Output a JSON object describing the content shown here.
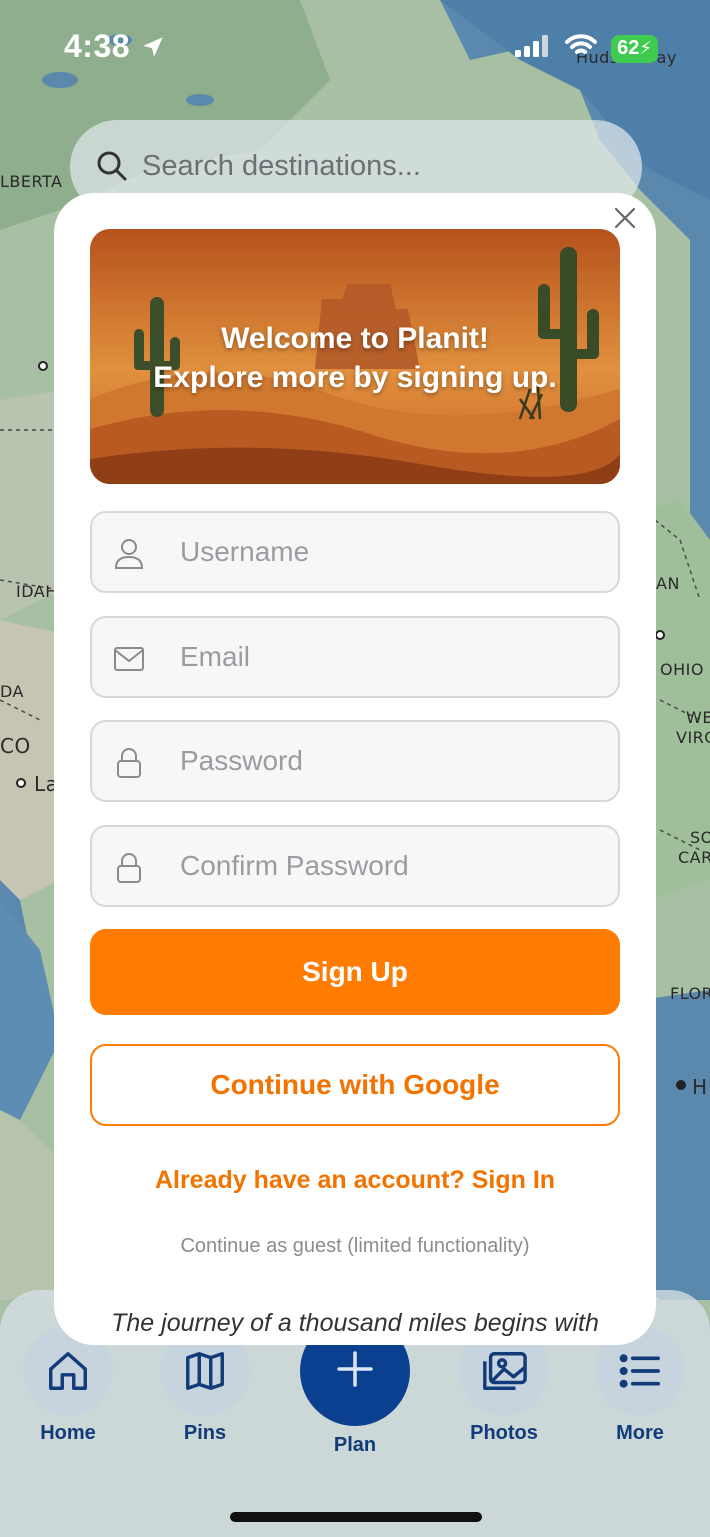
{
  "status_bar": {
    "time": "4:38",
    "battery": "62",
    "icons": [
      "location-arrow-icon",
      "signal-icon",
      "wifi-icon",
      "battery-charging-icon"
    ]
  },
  "map": {
    "labels": {
      "hudson_bay": "Hudson Bay",
      "alberta": "LBERTA",
      "idaho": "IDAH",
      "da": "DA",
      "co": "CO",
      "la": "La",
      "an": "AN",
      "ohio": "OHIO",
      "we": "WE",
      "virg": "VIRG",
      "so": "SO",
      "car": "CAR",
      "flor": "FLOR",
      "h": "H"
    }
  },
  "search": {
    "placeholder": "Search destinations..."
  },
  "modal": {
    "hero": {
      "title_line1": "Welcome to Planit!",
      "title_line2": "Explore more by signing up."
    },
    "fields": {
      "username": {
        "placeholder": "Username",
        "icon": "user-icon"
      },
      "email": {
        "placeholder": "Email",
        "icon": "envelope-icon"
      },
      "password": {
        "placeholder": "Password",
        "icon": "lock-icon"
      },
      "confirm_password": {
        "placeholder": "Confirm Password",
        "icon": "lock-icon"
      }
    },
    "signup_label": "Sign Up",
    "google_label": "Continue with Google",
    "signin_link": "Already have an account? Sign In",
    "guest_link": "Continue as guest (limited functionality)",
    "quote": "The journey of a thousand miles begins with"
  },
  "tab_bar": {
    "home": "Home",
    "pins": "Pins",
    "plan": "Plan",
    "photos": "Photos",
    "more": "More"
  },
  "colors": {
    "accent": "#ff7c00",
    "nav": "#123b7a",
    "plan_button": "#0b3f8f"
  }
}
